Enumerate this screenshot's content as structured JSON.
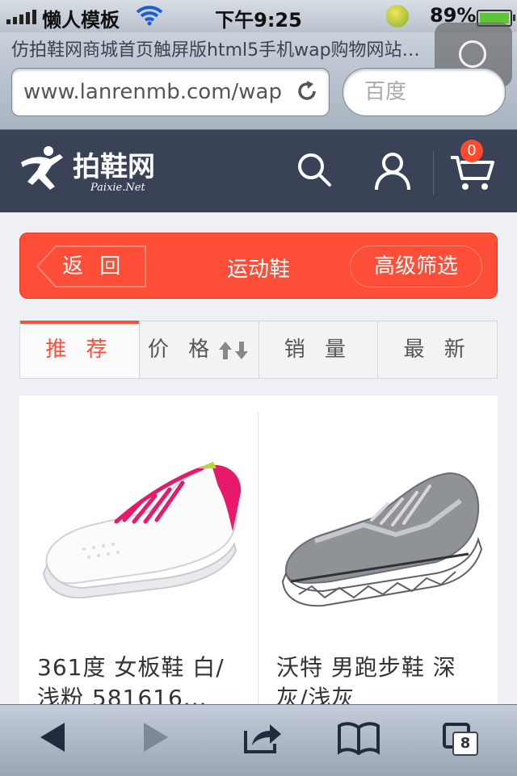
{
  "status_bar": {
    "carrier": "懒人模板",
    "time": "下午9:25",
    "battery_percent": "89%",
    "battery_level": 0.89,
    "icons": [
      "signal-icon",
      "wifi-icon",
      "sync-icon",
      "battery-icon"
    ]
  },
  "browser": {
    "page_title": "仿拍鞋网商城首页触屏版html5手机wap购物网站模...",
    "url": "www.lanrenmb.com/wap",
    "search_placeholder": "百度",
    "tabs_count": "8"
  },
  "site_header": {
    "brand": "拍鞋网",
    "brand_sub": "Paixie.Net",
    "cart_count": "0",
    "bg_color": "#3a4257",
    "icons": [
      "search-icon",
      "user-icon",
      "cart-icon"
    ]
  },
  "title_bar": {
    "back_label": "返 回",
    "title": "运动鞋",
    "filter_label": "高级筛选",
    "accent_color": "#fe4e37"
  },
  "sort_tabs": [
    {
      "label": "推 荐",
      "active": true
    },
    {
      "label": "价 格",
      "active": false,
      "icon": "sort-arrows-icon"
    },
    {
      "label": "销 量",
      "active": false
    },
    {
      "label": "最 新",
      "active": false
    }
  ],
  "products": [
    {
      "name": "361度 女板鞋 白/浅粉 581616...",
      "image": "white-pink-sneaker"
    },
    {
      "name": "沃特 男跑步鞋 深灰/浅灰",
      "image": "gray-running-shoe"
    }
  ]
}
